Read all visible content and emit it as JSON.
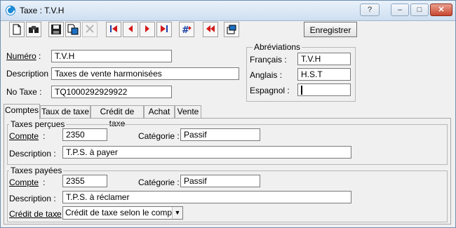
{
  "window": {
    "title": "Taxe : T.V.H",
    "help_btn": "?",
    "min_btn": "–",
    "max_btn": "□",
    "close_btn": "✕"
  },
  "toolbar": {
    "save_label": "Enregistrer",
    "icons": [
      "new-document-icon",
      "find-icon",
      "save-icon",
      "copy-icon",
      "delete-icon",
      "first-record-icon",
      "previous-record-icon",
      "next-record-icon",
      "last-record-icon",
      "goto-record-icon",
      "rewind-icon",
      "window-icon"
    ]
  },
  "header": {
    "numero_label": "Numéro",
    "numero_value": "T.V.H",
    "description_label": "Description :",
    "description_value": "Taxes de vente harmonisées",
    "notaxe_label": "No Taxe :",
    "notaxe_value": "TQ1000292929922"
  },
  "abbreviations": {
    "title": "Abréviations",
    "francais_label": "Français :",
    "francais_value": "T.V.H",
    "anglais_label": "Anglais :",
    "anglais_value": "H.S.T",
    "espagnol_label": "Espagnol :",
    "espagnol_value": ""
  },
  "tabs": [
    "Comptes",
    "Taux de taxe",
    "Crédit de taxe",
    "Achat",
    "Vente"
  ],
  "taxes_percues": {
    "title": "Taxes perçues",
    "compte_label": "Compte",
    "compte_value": "2350",
    "categorie_label": "Catégorie :",
    "categorie_value": "Passif",
    "description_label": "Description :",
    "description_value": "T.P.S. à payer"
  },
  "taxes_payees": {
    "title": "Taxes payées",
    "compte_label": "Compte",
    "compte_value": "2355",
    "categorie_label": "Catégorie :",
    "categorie_value": "Passif",
    "description_label": "Description :",
    "description_value": "T.P.S. à réclamer",
    "credit_label": "Crédit de taxe",
    "credit_value": "Crédit de taxe selon le compte"
  },
  "colors": {
    "nav_red": "#d41a1a",
    "nav_blue": "#1a3fa8"
  }
}
